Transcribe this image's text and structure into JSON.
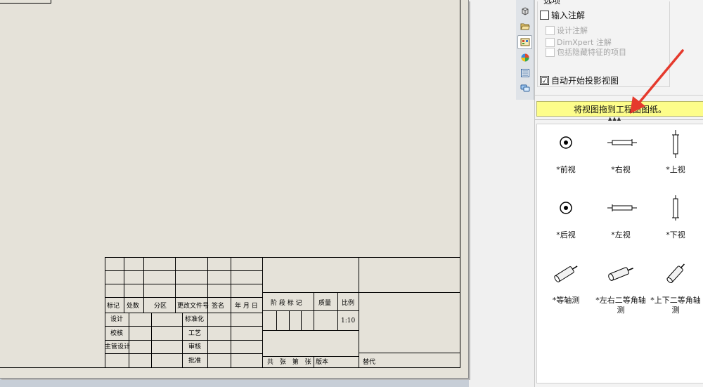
{
  "options": {
    "title": "选项",
    "import_annotations": "输入注解",
    "design_annotations": "设计注解",
    "dimxpert_annotations": "DimXpert 注解",
    "include_hidden": "包括隐藏特征的项目",
    "auto_start_projected": "自动开始投影视图",
    "auto_start_checked": "☑"
  },
  "hint": "将视图拖到工程图图纸。",
  "views": [
    {
      "label": "*前视",
      "icon": "front-view-icon"
    },
    {
      "label": "*右视",
      "icon": "right-view-icon"
    },
    {
      "label": "*上视",
      "icon": "top-view-icon"
    },
    {
      "label": "*后视",
      "icon": "back-view-icon"
    },
    {
      "label": "*左视",
      "icon": "left-view-icon"
    },
    {
      "label": "*下视",
      "icon": "bottom-view-icon"
    },
    {
      "label": "*等轴测",
      "icon": "isometric-view-icon"
    },
    {
      "label": "*左右二等角轴测",
      "icon": "dimetric-lr-view-icon"
    },
    {
      "label": "*上下二等角轴测",
      "icon": "dimetric-tb-view-icon"
    }
  ],
  "title_block": {
    "mark": "标记",
    "count": "处数",
    "zone": "分区",
    "change_doc": "更改文件号",
    "signature": "签名",
    "date": "年 月 日",
    "stage_mark": "阶 段 标 记",
    "weight": "质量",
    "scale": "比例",
    "scale_value": "1:10",
    "design": "设计",
    "standardize": "标准化",
    "check": "校核",
    "process": "工艺",
    "chief_designer": "主管设计",
    "review": "审核",
    "approve": "批准",
    "sheets": "共 张 第 张",
    "version": "版本",
    "replace": "替代"
  },
  "tabs": [
    "model-icon",
    "folder-icon",
    "view-palette-icon",
    "appearance-icon",
    "properties-icon",
    "comments-icon"
  ],
  "colors": {
    "hint_bg": "#fdfd8a",
    "arrow": "#e53a2d",
    "sheet": "#e5e2d9"
  }
}
